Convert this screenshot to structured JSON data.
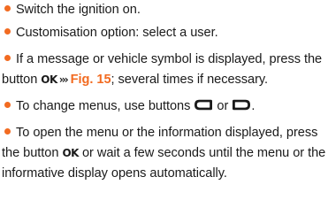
{
  "steps": [
    {
      "text": "Switch the ignition on."
    },
    {
      "text": "Customisation option: select a user."
    },
    {
      "before": "If a message or vehicle symbol is displayed, press the button",
      "button": "OK",
      "arrow": "›››",
      "figref": "Fig. 15",
      "after": "; several times if necessary."
    },
    {
      "before": "To change menus, use buttons",
      "between": "or",
      "after": "."
    },
    {
      "before": "To open the menu or the information displayed, press the button",
      "button": "OK",
      "after": "or wait a few seconds until the menu or the informative display opens automatically."
    }
  ],
  "colors": {
    "accent": "#f26b21",
    "text": "#1a1a1a"
  },
  "icons": {
    "bullet": "orange-dot",
    "button_left": "rounded-rect-button-left-icon",
    "button_right": "rounded-rect-button-right-icon"
  }
}
